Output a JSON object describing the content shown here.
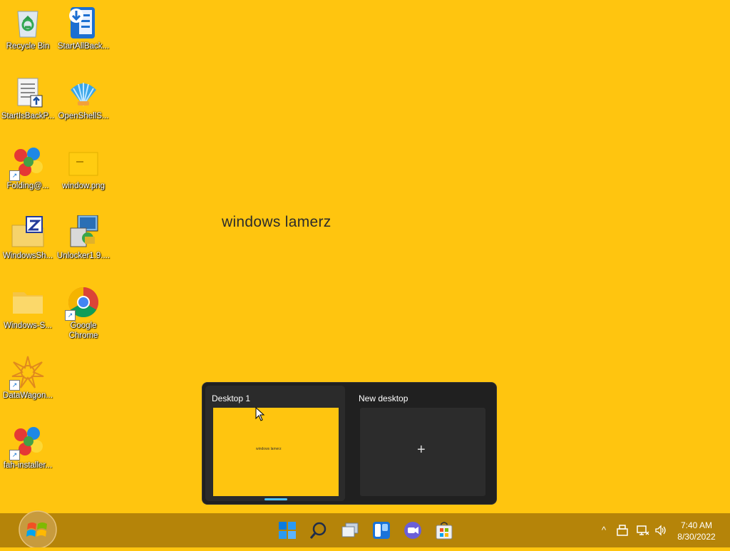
{
  "desktop": {
    "wallpaper_text": "windows lamerz",
    "background_color": "#FFC50F",
    "icons": [
      {
        "label": "Recycle Bin",
        "icon": "recycle-bin-icon"
      },
      {
        "label": "StartAllBack...",
        "icon": "startallback-installer-icon"
      },
      {
        "label": "StartIsBackP...",
        "icon": "startisback-document-icon"
      },
      {
        "label": "OpenShellS...",
        "icon": "openshell-icon"
      },
      {
        "label": "Folding@...",
        "icon": "folding-at-home-icon"
      },
      {
        "label": "window.png",
        "icon": "png-file-icon"
      },
      {
        "label": "WindowsSh...",
        "icon": "zip-archive-icon"
      },
      {
        "label": "Unlocker1.9....",
        "icon": "unlocker-installer-icon"
      },
      {
        "label": "Windows-S...",
        "icon": "folder-icon"
      },
      {
        "label": "Google Chrome",
        "icon": "chrome-icon"
      },
      {
        "label": "DataWagon...",
        "icon": "datawagon-icon"
      },
      {
        "label": "fah-installer...",
        "icon": "fah-installer-icon"
      }
    ]
  },
  "task_view": {
    "desktops": [
      {
        "title": "Desktop 1",
        "thumb_text": "windows lamerz",
        "active": true
      },
      {
        "title": "New desktop",
        "add_glyph": "+"
      }
    ]
  },
  "taskbar": {
    "color": "#B58409",
    "items": [
      "start-orb-icon",
      "windows-logo-icon",
      "search-icon",
      "task-view-icon",
      "widgets-icon",
      "chat-icon",
      "store-icon"
    ],
    "tray": {
      "chevron": "^",
      "time": "7:40 AM",
      "date": "8/30/2022"
    }
  }
}
